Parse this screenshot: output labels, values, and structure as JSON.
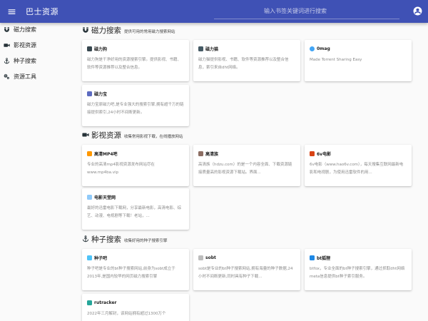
{
  "header": {
    "title": "巴士资源",
    "search_placeholder": "输入书签关键词进行搜索",
    "menu_icon": "menu-icon",
    "account_icon": "account-circle-icon"
  },
  "sidebar": {
    "items": [
      {
        "label": "磁力搜索",
        "icon": "magnet-icon"
      },
      {
        "label": "影视资源",
        "icon": "video-camera-icon"
      },
      {
        "label": "种子搜索",
        "icon": "anchor-icon"
      },
      {
        "label": "资源工具",
        "icon": "gears-icon"
      }
    ]
  },
  "sections": [
    {
      "title": "磁力搜索",
      "subtitle": "提供可用的常用磁力搜索网站",
      "icon": "magnet-icon",
      "cards": [
        {
          "name": "磁力狗",
          "desc": "磁力狗是干净好用的资源搜索引擎。提供影视、书籍、软件等资源推荐以及整合信息。",
          "logo_color": "#37474f"
        },
        {
          "name": "磁力猫",
          "desc": "磁力猫提供影视、书籍、软件等资源推荐以及整合信息，索引来自dht网络。",
          "logo_color": "#455a64"
        },
        {
          "name": "0mag",
          "desc": "Made Torrent Sharing Easy",
          "logo_color": "#42a5f5"
        },
        {
          "name": "磁力宝",
          "desc": "磁力宝原磁力吧,是专业强大的搜索引擎,拥有超千万的链接提供索引,24小时不间断更新。",
          "logo_color": "#5c6bc0"
        }
      ]
    },
    {
      "title": "影视资源",
      "subtitle": "收集常用影视下载，在线播放网站",
      "icon": "video-camera-icon",
      "cards": [
        {
          "name": "高清MP4吧",
          "desc": "专业的高清mp4影视资源发布网站尽在www.mp4ba.vip",
          "logo_color": "#ff9800"
        },
        {
          "name": "高清族",
          "desc": "高清族（hdzu.com）的是一个内容全面、下载资源链接质量高的影视资源下载站。界面...",
          "logo_color": "#8d6e63"
        },
        {
          "name": "6v电影",
          "desc": "6v电影（www.hao6v.com），每天搜集互联网最新电影和电视剧，为使用迅雷软件的用...",
          "logo_color": "#d84315"
        },
        {
          "name": "电影天堂网",
          "desc": "最好的迅雷电影下载网，分享最新电影，高清电影、综艺、动漫、电视剧等下载！老站，...",
          "logo_color": "#90caf9"
        }
      ]
    },
    {
      "title": "种子搜索",
      "subtitle": "收集好用的种子搜索引擎",
      "icon": "anchor-icon",
      "cards": [
        {
          "name": "种子吧",
          "desc": "种子吧是专业的bt种子搜索网站,前身为sobt成立于2013年,是国内较早的网页磁力搜索引擎",
          "logo_color": "#4fc3f7"
        },
        {
          "name": "sobt",
          "desc": "sobt是专业的bt种子搜索网站,拥有海量的种子数据,24小时不间断更新,同时具有种子下载...",
          "logo_color": "#bdbdbd"
        },
        {
          "name": "bt狐狸",
          "desc": "btfox，专业全面的bt种子搜索引擎，通过抓取dht网络meta信息提供bt种子索引服务。",
          "logo_color": "#1e88e5"
        },
        {
          "name": "rutracker",
          "desc": "2022年三月解封，该网站拥有超过1300万个",
          "logo_color": "#26a69a"
        }
      ]
    }
  ]
}
